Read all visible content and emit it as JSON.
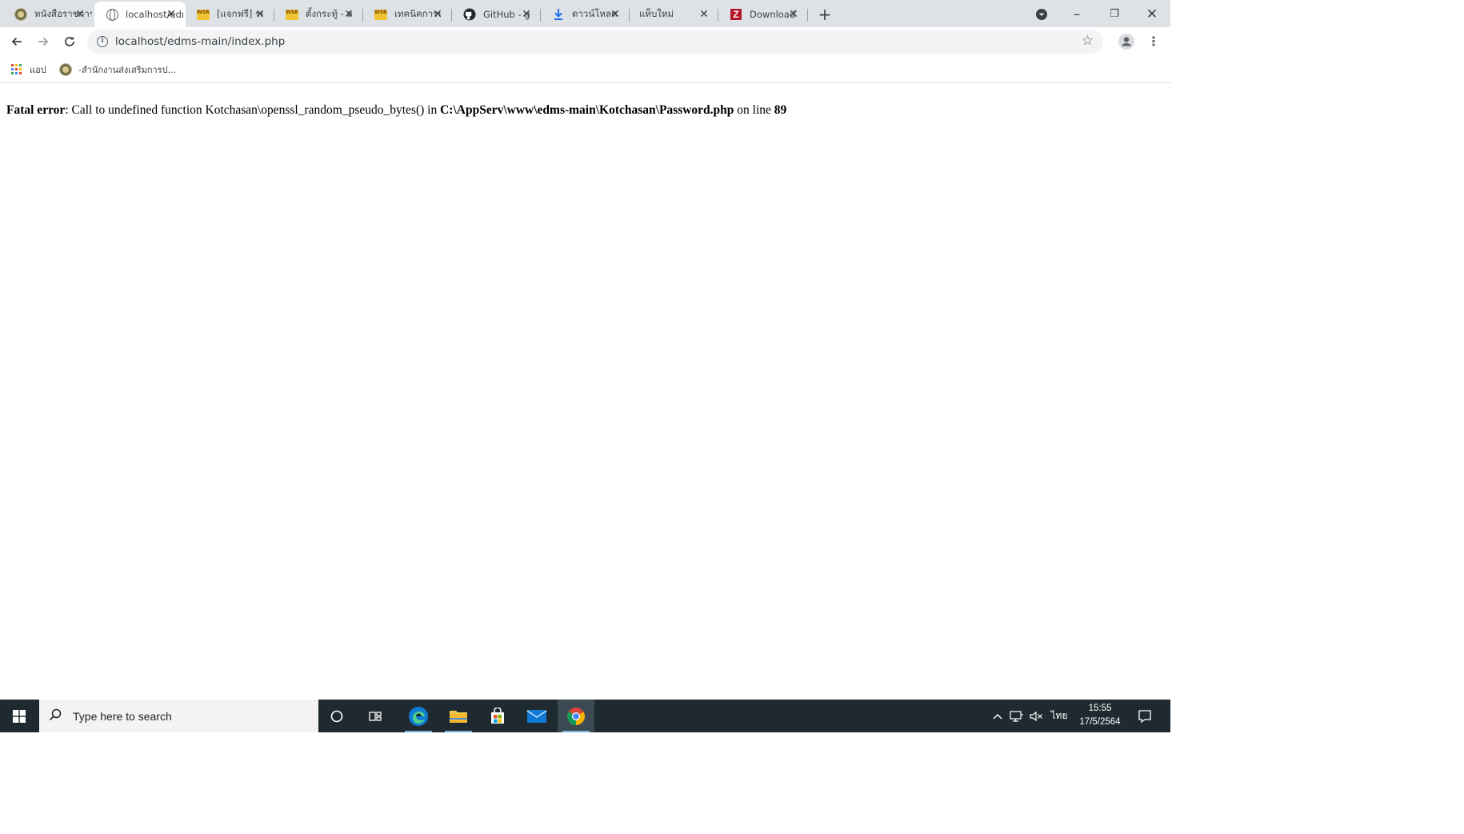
{
  "browser": {
    "tabs": [
      {
        "title": "หนังสือราชการ",
        "favicon": "seal-icon",
        "active": false
      },
      {
        "title": "localhost/edms-main",
        "favicon": "globe-icon",
        "active": true
      },
      {
        "title": "[แจกฟรี] ระบบ",
        "favicon": "wsr-icon",
        "active": false
      },
      {
        "title": "ตั้งกระทู้ - ลงฯ",
        "favicon": "wsr-icon",
        "active": false
      },
      {
        "title": "เทคนิคการปรับ",
        "favicon": "wsr-icon",
        "active": false
      },
      {
        "title": "GitHub - go",
        "favicon": "github-icon",
        "active": false
      },
      {
        "title": "ดาวน์โหลด",
        "favicon": "download-icon",
        "active": false
      },
      {
        "title": "แท็บใหม่",
        "favicon": "",
        "active": false
      },
      {
        "title": "Download F",
        "favicon": "filezilla-icon",
        "active": false
      }
    ],
    "address": {
      "url": "localhost/edms-main/index.php"
    },
    "bookmarks": [
      {
        "label": "แอป",
        "icon": "apps-grid-icon"
      },
      {
        "label": "-สำนักงานส่งเสริมการป...",
        "icon": "seal-icon"
      }
    ]
  },
  "page": {
    "error_label": "Fatal error",
    "error_message": ": Call to undefined function Kotchasan\\openssl_random_pseudo_bytes() in ",
    "error_path": "C:\\AppServ\\www\\edms-main\\Kotchasan\\Password.php",
    "error_line_text": " on line ",
    "error_line_number": "89"
  },
  "taskbar": {
    "search_placeholder": "Type here to search",
    "language": "ไทย",
    "time": "15:55",
    "date": "17/5/2564"
  },
  "colors": {
    "tabstrip": "#dee1e6",
    "taskbar": "#1f2a30",
    "active_underline": "#78b4e6"
  }
}
